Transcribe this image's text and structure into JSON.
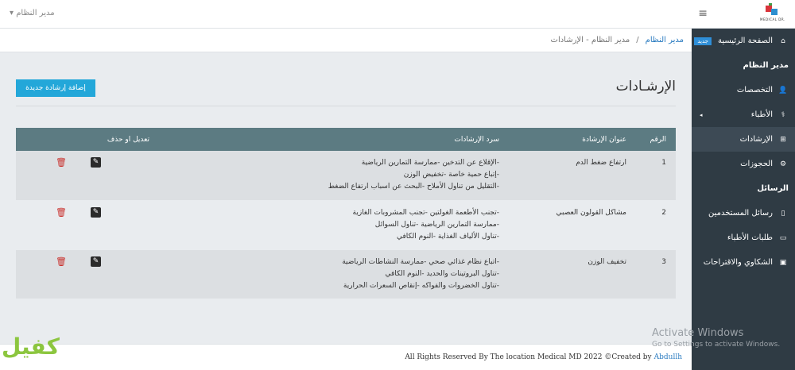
{
  "header": {
    "logo_text": "MEDICAL DR.",
    "menu_icon": "hamburger-icon",
    "user_label": "مدير النظام"
  },
  "sidebar": {
    "home_label": "الصفحة الرئيسية",
    "home_badge": "جديد",
    "admin_section": "مدير النظام",
    "items": [
      {
        "label": "التخصصات",
        "icon": "user-plus-icon"
      },
      {
        "label": "الأطباء",
        "icon": "doctor-icon"
      },
      {
        "label": "الإرشادات",
        "icon": "sitemap-icon"
      },
      {
        "label": "الحجوزات",
        "icon": "gears-icon"
      }
    ],
    "messages_section": "الرسائل",
    "message_items": [
      {
        "label": "رسائل المستخدمين",
        "icon": "mobile-icon"
      },
      {
        "label": "طلبات الأطباء",
        "icon": "desktop-icon"
      },
      {
        "label": "الشكاوي والاقتراحات",
        "icon": "image-icon"
      }
    ]
  },
  "breadcrumb": {
    "root": "مدير النظام",
    "separator": "/",
    "current": "مدير النظام - الإرشادات"
  },
  "main": {
    "title": "الإرشـادات",
    "add_button": "إضافة إرشادة جديدة"
  },
  "table": {
    "headers": [
      "الرقم",
      "عنوان الإرشادة",
      "سرد الإرشادات",
      "تعديل او حذف"
    ],
    "rows": [
      {
        "num": "1",
        "title": "ارتفاع ضغط الدم",
        "lines": [
          "-الإقلاع عن التدخين -ممارسة التمارين الرياضية",
          "-إتباع حمية خاصة -تخفيض الوزن",
          "-التقليل من تناول الأملاح -البحث عن اسباب ارتفاع الضغط"
        ]
      },
      {
        "num": "2",
        "title": "مشاكل القولون العصبي",
        "lines": [
          "-تجنب الأطعمة الغولتين -تجنب المشروبات الغازية",
          "-ممارسة التمارين الرياضية -تناول السوائل",
          "-تناول الألياف الغذاية -النوم الكافي"
        ]
      },
      {
        "num": "3",
        "title": "تخفيف الوزن",
        "lines": [
          "-اتباع نظام غذائي صحي -ممارسة النشاطات الرياضية",
          "-تناول البروتينات والحديد -النوم الكافي",
          "-تناول الخضروات والفواكه -إنقاص السعرات الحرارية"
        ]
      }
    ]
  },
  "footer": {
    "text": "All Rights Reserved By The location Medical MD 2022 ©Created by",
    "credit": "Abdullh"
  },
  "overlay": {
    "activate_title": "Activate Windows",
    "activate_sub": "Go to Settings to activate Windows.",
    "corner_logo": "كفيل"
  }
}
